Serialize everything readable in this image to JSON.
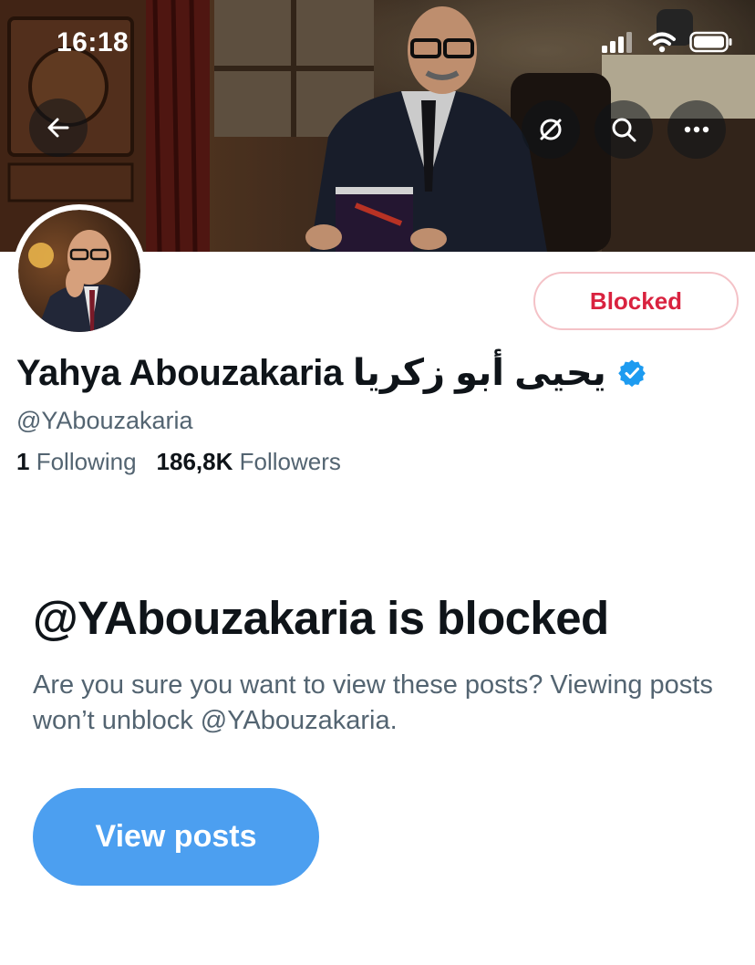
{
  "status_bar": {
    "time": "16:18"
  },
  "header": {
    "icons": [
      "back-arrow-icon",
      "translate-icon",
      "search-icon",
      "more-icon"
    ]
  },
  "profile": {
    "display_name": "Yahya Abouzakaria يحيى أبو زكريا",
    "verified": true,
    "verified_color": "#1d9bf0",
    "handle": "@YAbouzakaria",
    "following_count": "1",
    "following_label": "Following",
    "followers_count": "186,8K",
    "followers_label": "Followers",
    "blocked_label": "Blocked",
    "blocked_color": "#d9223f"
  },
  "notice": {
    "title": "@YAbouzakaria is blocked",
    "description": "Are you sure you want to view these posts? Viewing posts won’t unblock @YAbouzakaria.",
    "button_label": "View posts",
    "button_color": "#4c9ff0"
  }
}
